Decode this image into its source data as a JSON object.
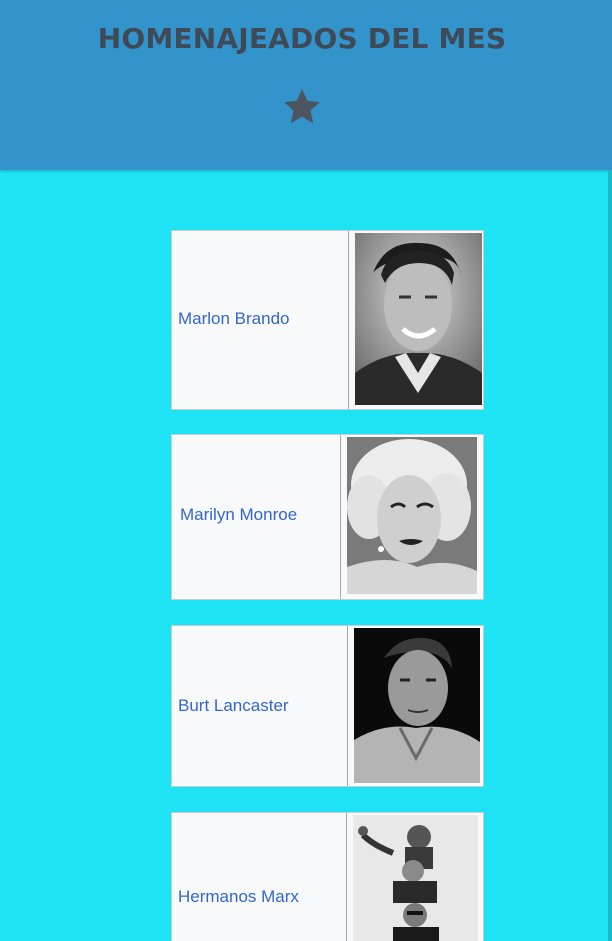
{
  "header": {
    "title": "HOMENAJEADOS DEL MES",
    "icon": "star-icon",
    "background": "#3394cc",
    "title_color": "#3e4a57"
  },
  "page": {
    "background": "#1ee3f4",
    "link_color": "#3366cc"
  },
  "honorees": [
    {
      "name": "Marlon Brando",
      "photo": "portrait-photo"
    },
    {
      "name": "Marilyn Monroe",
      "photo": "portrait-photo"
    },
    {
      "name": "Burt Lancaster",
      "photo": "portrait-photo"
    },
    {
      "name": "Hermanos Marx",
      "photo": "group-photo"
    }
  ]
}
